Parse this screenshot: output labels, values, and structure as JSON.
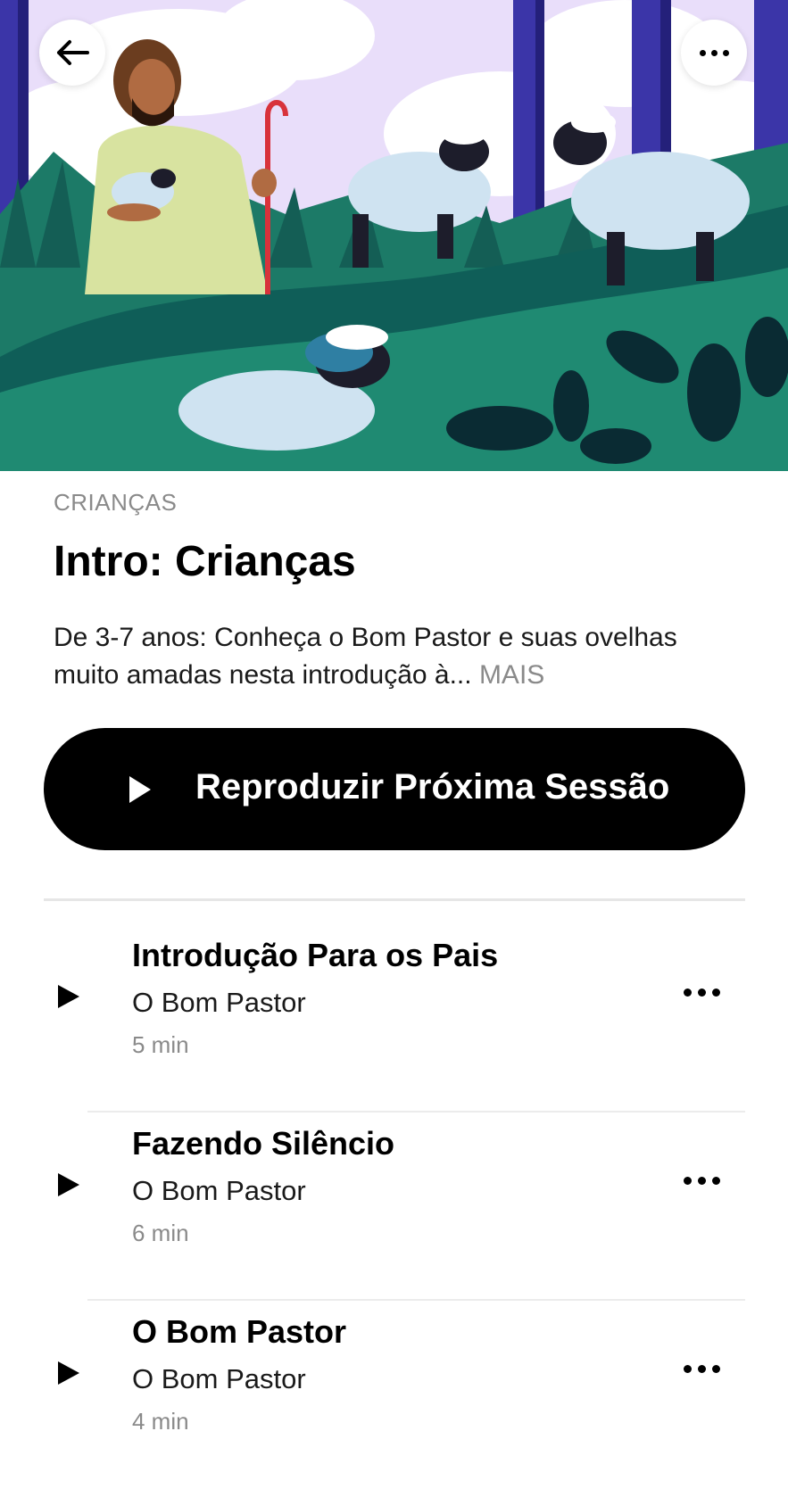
{
  "header": {
    "back_icon": "arrow-left-icon",
    "more_icon": "ellipsis-icon"
  },
  "course": {
    "category": "CRIANÇAS",
    "title": "Intro: Crianças",
    "description": "De 3-7 anos: Conheça o Bom Pastor e suas ovelhas muito amadas nesta introdução à...",
    "more_label": " MAIS"
  },
  "play_next": {
    "label": "Reproduzir Próxima Sessão",
    "icon": "play-icon"
  },
  "sessions": [
    {
      "title": "Introdução Para os Pais",
      "subtitle": "O Bom Pastor",
      "duration": "5 min"
    },
    {
      "title": "Fazendo Silêncio",
      "subtitle": "O Bom Pastor",
      "duration": "6 min"
    },
    {
      "title": "O Bom Pastor",
      "subtitle": "O Bom Pastor",
      "duration": "4 min"
    }
  ],
  "colors": {
    "sky": "#e9defa",
    "grass_dark": "#0f5e58",
    "grass_mid": "#1f8a72",
    "tree": "#3b35a8",
    "sheep": "#cfe3f1",
    "robe": "#d8e3a0",
    "button_bg": "#000000",
    "muted_text": "#8a8a8a"
  }
}
